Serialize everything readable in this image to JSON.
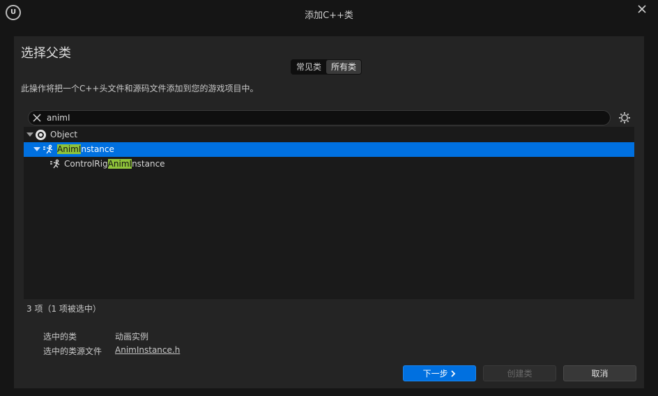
{
  "window": {
    "title": "添加C++类"
  },
  "dialog": {
    "heading": "选择父类",
    "tabs": [
      {
        "label": "常见类",
        "active": false
      },
      {
        "label": "所有类",
        "active": true
      }
    ],
    "description": "此操作将把一个C++头文件和源码文件添加到您的游戏项目中。",
    "search": {
      "value": "animI"
    },
    "tree": {
      "root": {
        "label": "Object"
      },
      "items": [
        {
          "pre": "",
          "match": "AnimI",
          "post": "nstance",
          "selected": true
        },
        {
          "pre": "ControlRig",
          "match": "AnimI",
          "post": "nstance",
          "selected": false
        }
      ]
    },
    "count_text": "3 项（1 项被选中）",
    "selected_class_label": "选中的类",
    "selected_class_value": "动画实例",
    "source_file_label": "选中的类源文件",
    "source_file_value": "AnimInstance.h",
    "buttons": {
      "next": "下一步",
      "create": "创建类",
      "cancel": "取消"
    }
  },
  "colors": {
    "accent": "#0070e0",
    "highlight": "#8fc33a"
  }
}
